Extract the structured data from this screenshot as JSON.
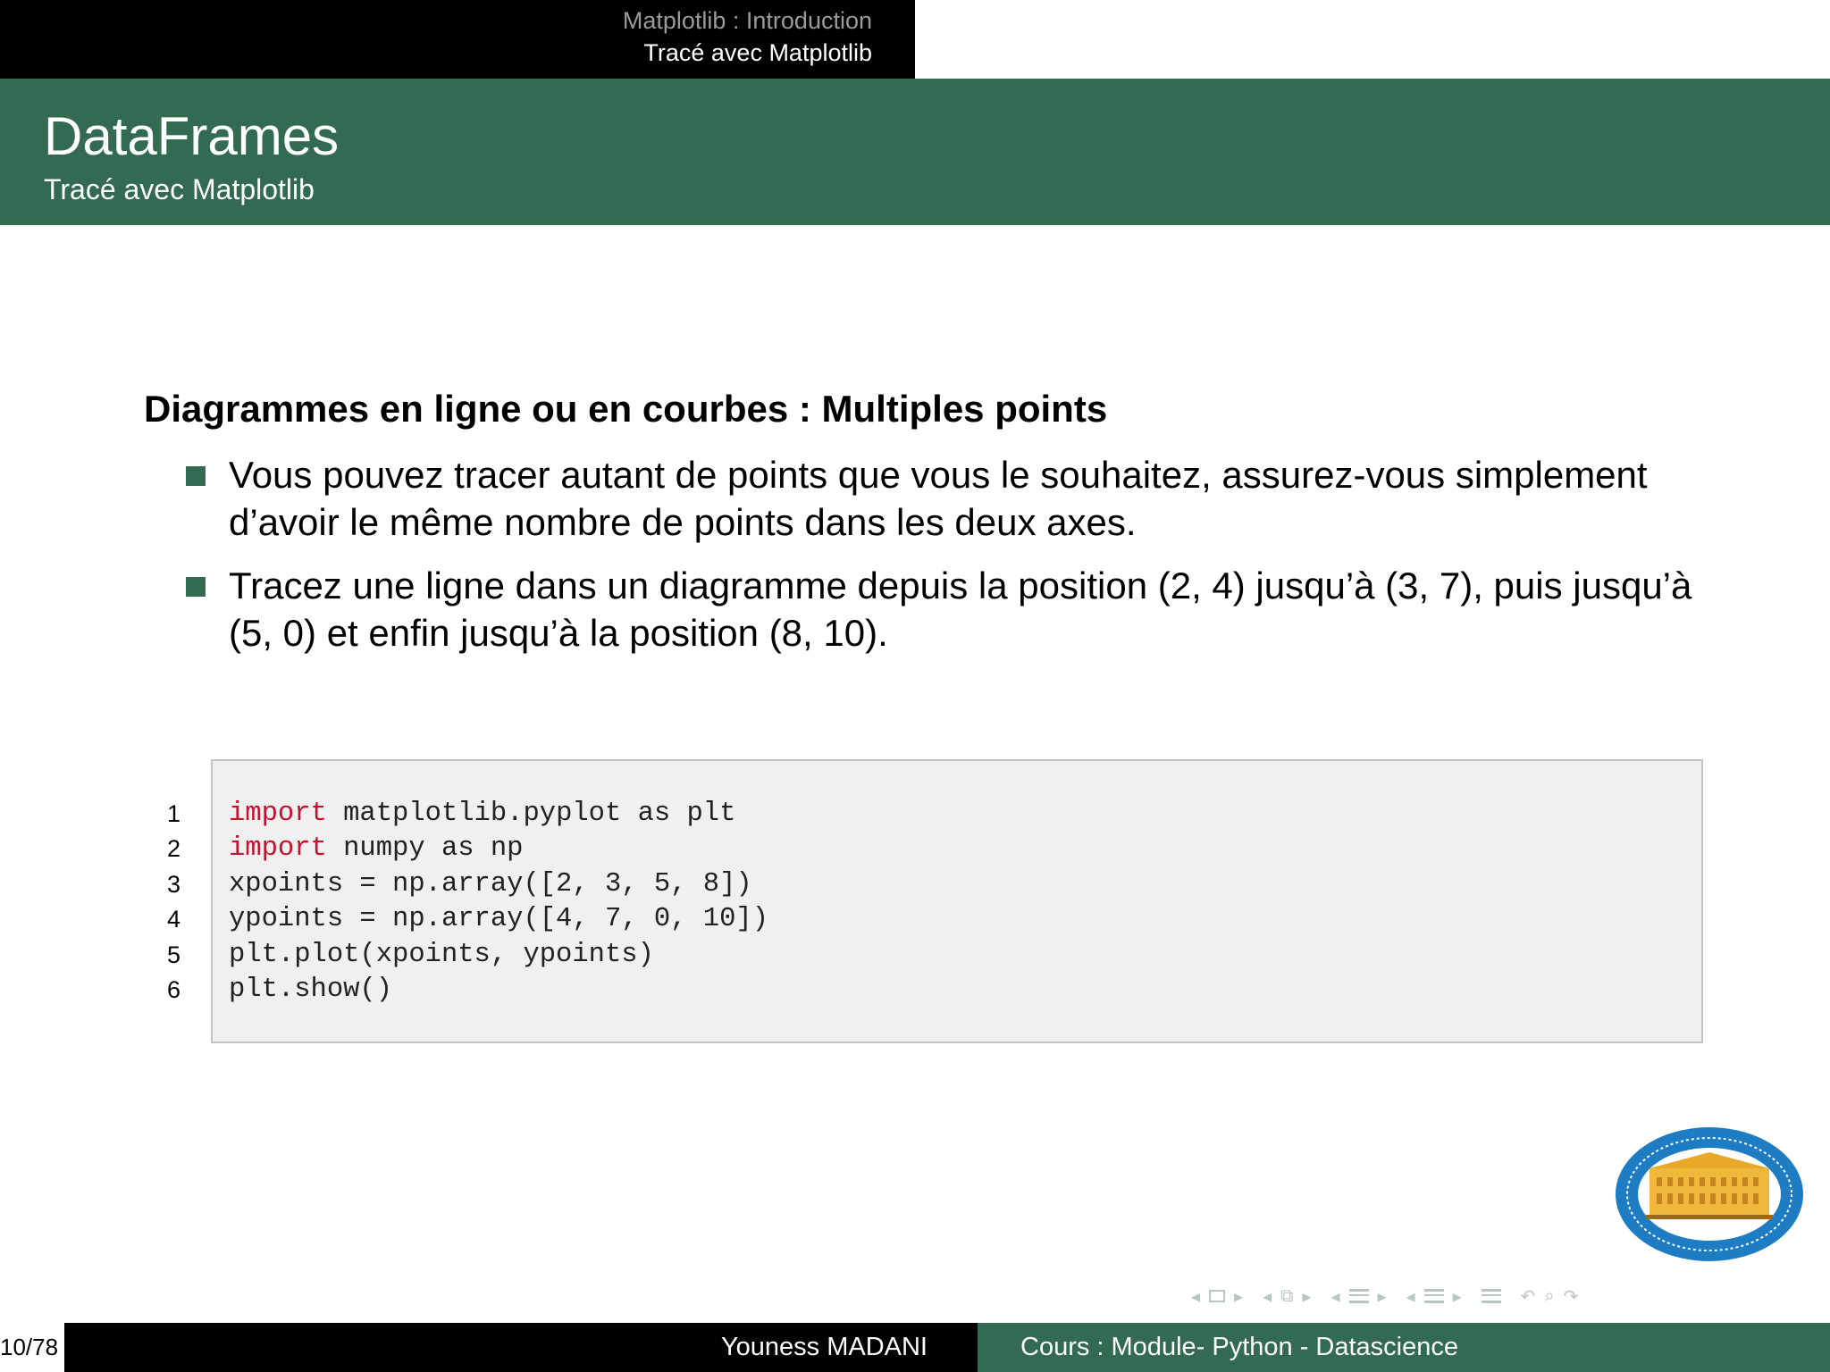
{
  "header": {
    "section": "Matplotlib : Introduction",
    "subsection": "Tracé avec Matplotlib"
  },
  "frame": {
    "title": "DataFrames",
    "subtitle": "Tracé avec Matplotlib"
  },
  "block": {
    "heading": "Diagrammes en ligne ou en courbes : Multiples points",
    "bullets": [
      "Vous pouvez tracer autant de points que vous le souhaitez, assurez-vous simplement d’avoir le même nombre de points dans les deux axes.",
      "Tracez une ligne dans un diagramme depuis la position (2, 4) jusqu’à (3, 7), puis jusqu’à (5, 0) et enfin jusqu’à la position (8, 10)."
    ]
  },
  "code": {
    "lines": [
      {
        "no": "1",
        "kw": "import",
        "rest": " matplotlib.pyplot as plt"
      },
      {
        "no": "2",
        "kw": "import",
        "rest": " numpy as np"
      },
      {
        "no": "3",
        "kw": "",
        "rest": "xpoints = np.array([2, 3, 5, 8])"
      },
      {
        "no": "4",
        "kw": "",
        "rest": "ypoints = np.array([4, 7, 0, 10])"
      },
      {
        "no": "5",
        "kw": "",
        "rest": "plt.plot(xpoints, ypoints)"
      },
      {
        "no": "6",
        "kw": "",
        "rest": "plt.show()"
      }
    ]
  },
  "colors": {
    "theme_green": "#336a52",
    "keyword_red": "#c8102e",
    "nav_symbols": "#b9c8bf"
  },
  "footer": {
    "page": "10/78",
    "author": "Youness MADANI",
    "course": "Cours : Module- Python - Datascience"
  }
}
